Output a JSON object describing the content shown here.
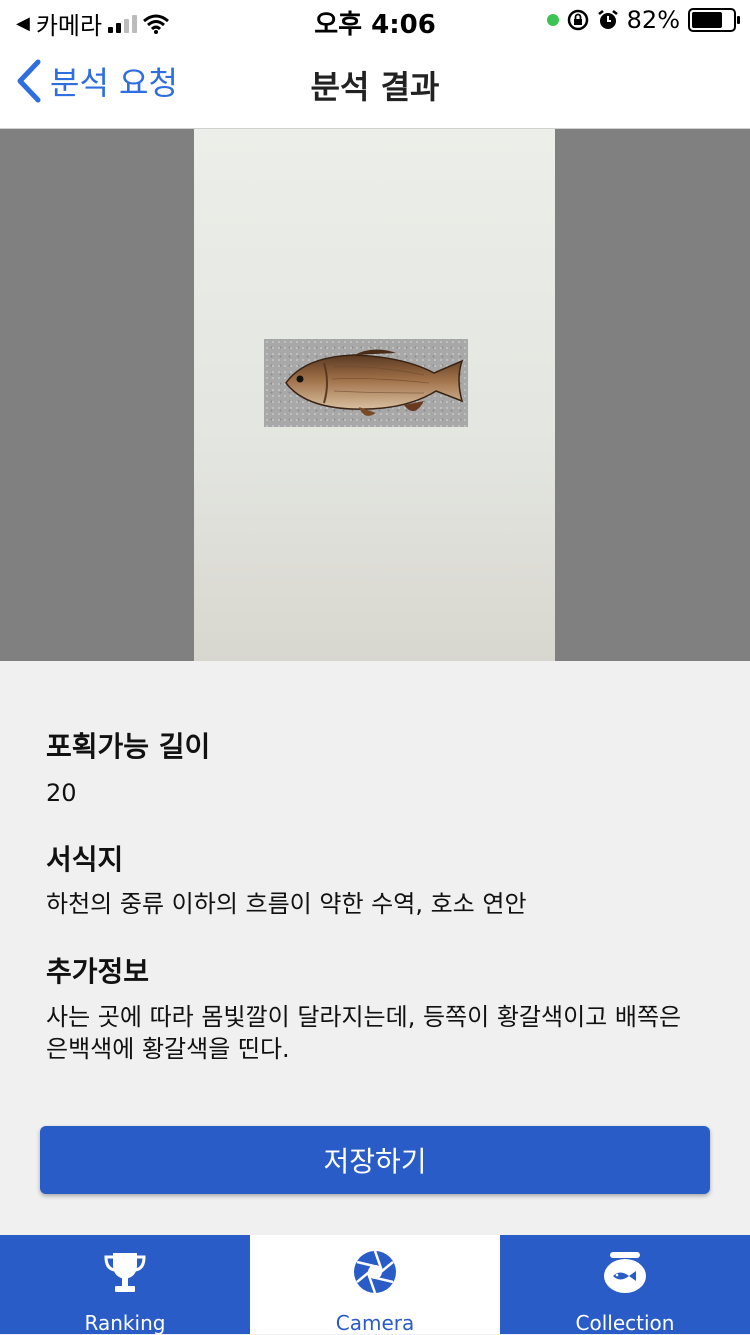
{
  "status_bar": {
    "back_app": "카메라",
    "time": "오후 4:06",
    "battery": "82%",
    "battery_level": 0.82
  },
  "nav": {
    "back_label": "분석 요청",
    "title": "분석 결과"
  },
  "result": {
    "length_title": "포획가능 길이",
    "length_value": "20",
    "habitat_title": "서식지",
    "habitat_value": "하천의 중류 이하의 흐름이 약한 수역, 호소 연안",
    "extra_title": "추가정보",
    "extra_value": "사는 곳에 따라 몸빛깔이 달라지는데, 등쪽이 황갈색이고 배쪽은 은백색에 황갈색을 띤다."
  },
  "save_button": "저장하기",
  "tabs": [
    {
      "label": "Ranking",
      "icon": "trophy-icon"
    },
    {
      "label": "Camera",
      "icon": "camera-aperture-icon"
    },
    {
      "label": "Collection",
      "icon": "fishbowl-icon"
    }
  ],
  "colors": {
    "accent": "#2a5cc7",
    "link": "#2f6ee0"
  }
}
